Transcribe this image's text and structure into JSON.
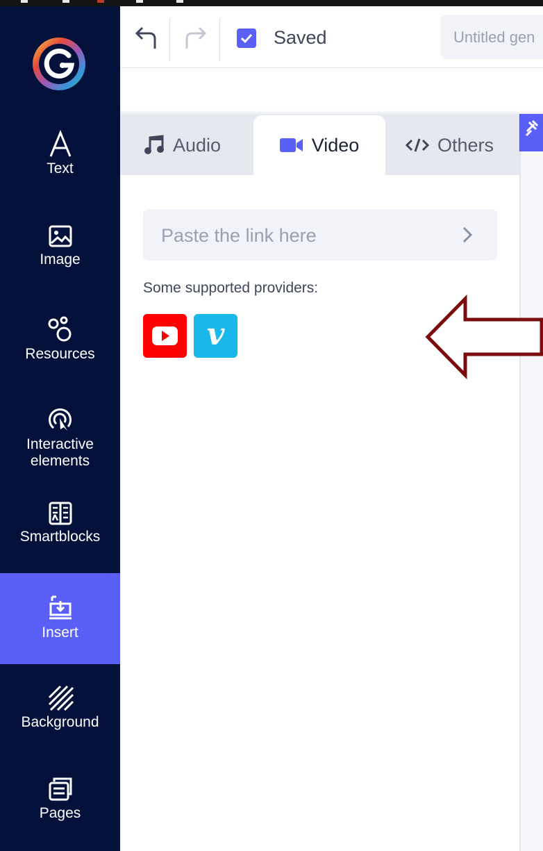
{
  "topbar": {
    "saved_label": "Saved",
    "doc_title": "Untitled gen",
    "undo_icon": "undo-icon",
    "redo_icon": "redo-icon"
  },
  "sidebar": {
    "items": [
      {
        "label": "Text",
        "icon": "text-icon"
      },
      {
        "label": "Image",
        "icon": "image-icon"
      },
      {
        "label": "Resources",
        "icon": "resources-icon"
      },
      {
        "label": "Interactive\nelements",
        "icon": "interactive-icon"
      },
      {
        "label": "Smartblocks",
        "icon": "smartblocks-icon"
      },
      {
        "label": "Insert",
        "icon": "insert-icon",
        "active": true
      },
      {
        "label": "Background",
        "icon": "background-icon"
      },
      {
        "label": "Pages",
        "icon": "pages-icon"
      }
    ]
  },
  "panel": {
    "tabs": [
      {
        "label": "Audio",
        "icon": "music-note-icon"
      },
      {
        "label": "Video",
        "icon": "video-camera-icon",
        "active": true
      },
      {
        "label": "Others",
        "icon": "code-icon"
      }
    ],
    "link_placeholder": "Paste the link here",
    "providers_label": "Some supported providers:",
    "providers": [
      "YouTube",
      "Vimeo"
    ],
    "vimeo_glyph": "v"
  },
  "colors": {
    "sidebar_bg": "#04113a",
    "accent": "#5a5ff7",
    "youtube": "#ff0000",
    "vimeo": "#1ab7ea",
    "arrow": "#7b0d0d"
  }
}
